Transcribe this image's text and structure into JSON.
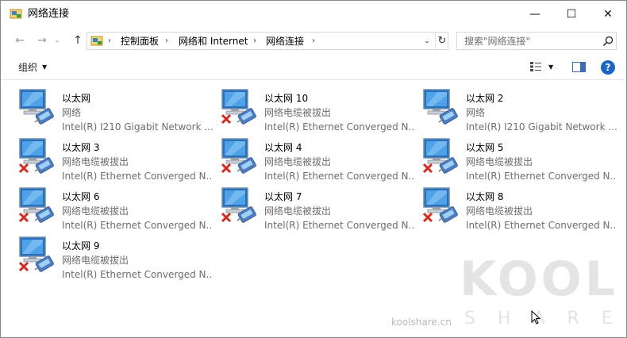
{
  "window": {
    "title": "网络连接",
    "controls": {
      "minimize": "—",
      "maximize": "☐",
      "close": "✕"
    }
  },
  "nav": {
    "back": "←",
    "forward": "→",
    "recent": "⌄",
    "up": "↑"
  },
  "address": {
    "separator": "›",
    "crumbs": [
      "控制面板",
      "网络和 Internet",
      "网络连接"
    ],
    "dropdown": "⌄",
    "refresh": "↻"
  },
  "search": {
    "placeholder": "搜索\"网络连接\""
  },
  "toolbar": {
    "organize": "组织",
    "organize_arrow": "▼",
    "view_arrow": "▼",
    "help": "?"
  },
  "connections": [
    {
      "name": "以太网",
      "status": "网络",
      "device": "Intel(R) I210 Gigabit Network ...",
      "disconnected": false
    },
    {
      "name": "以太网 10",
      "status": "网络电缆被拔出",
      "device": "Intel(R) Ethernet Converged N...",
      "disconnected": true
    },
    {
      "name": "以太网 2",
      "status": "网络",
      "device": "Intel(R) I210 Gigabit Network ...",
      "disconnected": false
    },
    {
      "name": "以太网 3",
      "status": "网络电缆被拔出",
      "device": "Intel(R) Ethernet Converged N...",
      "disconnected": true
    },
    {
      "name": "以太网 4",
      "status": "网络电缆被拔出",
      "device": "Intel(R) Ethernet Converged N...",
      "disconnected": true
    },
    {
      "name": "以太网 5",
      "status": "网络电缆被拔出",
      "device": "Intel(R) Ethernet Converged N...",
      "disconnected": true
    },
    {
      "name": "以太网 6",
      "status": "网络电缆被拔出",
      "device": "Intel(R) Ethernet Converged N...",
      "disconnected": true
    },
    {
      "name": "以太网 7",
      "status": "网络电缆被拔出",
      "device": "Intel(R) Ethernet Converged N...",
      "disconnected": true
    },
    {
      "name": "以太网 8",
      "status": "网络电缆被拔出",
      "device": "Intel(R) Ethernet Converged N...",
      "disconnected": true
    },
    {
      "name": "以太网 9",
      "status": "网络电缆被拔出",
      "device": "Intel(R) Ethernet Converged N...",
      "disconnected": true
    }
  ],
  "watermark": {
    "brand": "KOOL",
    "sub": "SHARE",
    "site": "koolshare.cn"
  },
  "colors": {
    "accent": "#1a66c4",
    "error": "#d9281e"
  }
}
